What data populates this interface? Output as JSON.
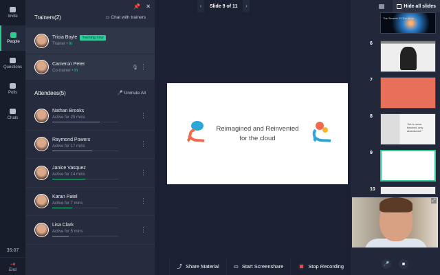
{
  "nav": {
    "items": [
      {
        "label": "Invite"
      },
      {
        "label": "People"
      },
      {
        "label": "Questions"
      },
      {
        "label": "Polls"
      },
      {
        "label": "Chats"
      }
    ],
    "timer": "35:07",
    "end_label": "End"
  },
  "panel": {
    "trainers_title": "Trainers(2)",
    "chat_trainers": "Chat with trainers",
    "trainers": [
      {
        "name": "Tricia Boyle",
        "badge": "Training now",
        "role": "Trainer",
        "status": "In"
      },
      {
        "name": "Cameron Peter",
        "role": "Co-trainer",
        "status": "In"
      }
    ],
    "attendees_title": "Attendees(5)",
    "unmute_all": "Unmute All",
    "attendees": [
      {
        "name": "Nathan Brooks",
        "activity": "Active for 25 mins",
        "progress": 0.72
      },
      {
        "name": "Raymond Powers",
        "activity": "Active for 17 mins",
        "progress": 0.6
      },
      {
        "name": "Janice Vasquez",
        "activity": "Active for 14 mins",
        "progress": 0.5
      },
      {
        "name": "Karan Patel",
        "activity": "Active for 7 mins",
        "progress": 0.3
      },
      {
        "name": "Lisa Clark",
        "activity": "Active for 5 mins",
        "progress": 0.25
      }
    ]
  },
  "slide_nav": {
    "label": "Slide 9 of 11"
  },
  "slide": {
    "line1": "Reimagined and Reinvented",
    "line2": "for the cloud"
  },
  "thumbs": {
    "hide_all": "Hide all slides",
    "items": [
      {
        "num": "6"
      },
      {
        "num": "7"
      },
      {
        "num": "8"
      },
      {
        "num": "9"
      },
      {
        "num": "10"
      }
    ],
    "t5_text": "The Secrets Of The Atom",
    "t8_text": "\"Art is never finished, only abandoned.\""
  },
  "bottom": {
    "share": "Share Material",
    "screenshare": "Start Screenshare",
    "stop_rec": "Stop Recording"
  },
  "colors": {
    "accent": "#2ecc8f",
    "record": "#e5484d",
    "slide7": "#e8705a"
  }
}
